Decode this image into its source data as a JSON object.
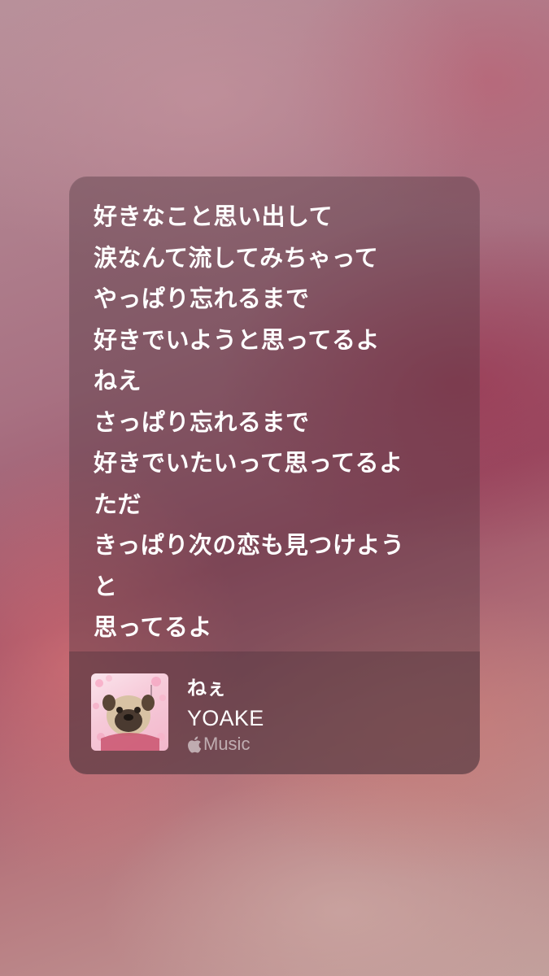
{
  "lyrics": {
    "lines": [
      "好きなこと思い出して",
      "涙なんて流してみちゃって",
      "やっぱり忘れるまで",
      "好きでいようと思ってるよ",
      "ねえ",
      "さっぱり忘れるまで",
      "好きでいたいって思ってるよ",
      "ただ",
      "きっぱり次の恋も見つけよう",
      "と",
      "思ってるよ"
    ]
  },
  "track": {
    "title": "ねぇ",
    "artist": "YOAKE",
    "service_label": "Music",
    "service_icon": "apple-logo-icon",
    "artwork_icon": "pug-album-artwork"
  },
  "colors": {
    "text_primary": "#ffffff",
    "text_secondary": "rgba(255,255,255,0.55)"
  }
}
